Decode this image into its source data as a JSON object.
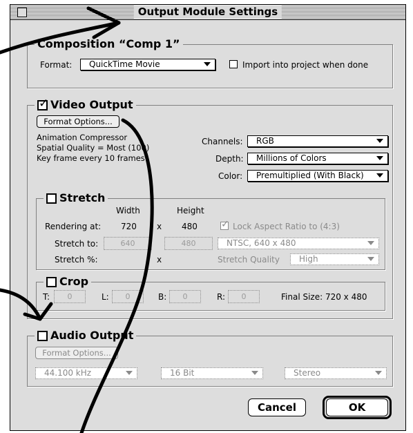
{
  "window": {
    "title": "Output Module Settings"
  },
  "composition": {
    "label": "Composition “Comp 1”",
    "format_label": "Format:",
    "format_value": "QuickTime Movie",
    "import_label": "Import into project when done"
  },
  "video": {
    "label": "Video Output",
    "checked": true,
    "format_options_label": "Format Options...",
    "info": [
      "Animation Compressor",
      "Spatial Quality = Most (100)",
      "Key frame every 10 frames"
    ],
    "channels_label": "Channels:",
    "channels_value": "RGB",
    "depth_label": "Depth:",
    "depth_value": "Millions of Colors",
    "color_label": "Color:",
    "color_value": "Premultiplied (With Black)"
  },
  "stretch": {
    "label": "Stretch",
    "width_header": "Width",
    "height_header": "Height",
    "rendering_label": "Rendering at:",
    "rendering_width": "720",
    "rendering_x": "x",
    "rendering_height": "480",
    "lock_label": "Lock Aspect Ratio to (4:3)",
    "stretch_to_label": "Stretch to:",
    "stretch_to_width": "640",
    "stretch_to_height": "480",
    "preset_value": "NTSC, 640 x 480",
    "stretch_pct_label": "Stretch %:",
    "stretch_pct_x": "x",
    "quality_label": "Stretch Quality",
    "quality_value": "High"
  },
  "crop": {
    "label": "Crop",
    "top_label": "T:",
    "top_value": "0",
    "left_label": "L:",
    "left_value": "0",
    "bottom_label": "B:",
    "bottom_value": "0",
    "right_label": "R:",
    "right_value": "0",
    "final_size": "Final Size: 720 x 480"
  },
  "audio": {
    "label": "Audio Output",
    "format_options_label": "Format Options...",
    "rate_value": "44.100 kHz",
    "bits_value": "16 Bit",
    "channels_value": "Stereo"
  },
  "buttons": {
    "cancel": "Cancel",
    "ok": "OK"
  }
}
